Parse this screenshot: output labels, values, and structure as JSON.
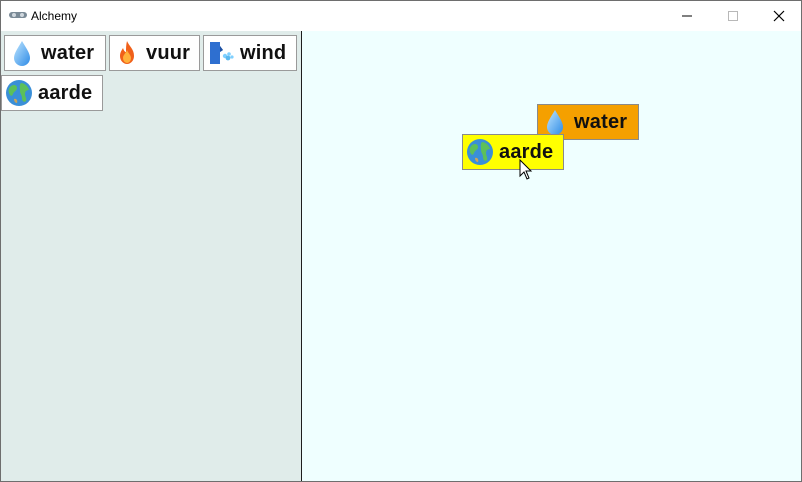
{
  "window": {
    "title": "Alchemy"
  },
  "sidebar": {
    "items": [
      {
        "label": "water",
        "icon": "water-drop-icon"
      },
      {
        "label": "vuur",
        "icon": "fire-icon"
      },
      {
        "label": "wind",
        "icon": "wind-icon"
      },
      {
        "label": "aarde",
        "icon": "earth-globe-icon"
      }
    ]
  },
  "canvas": {
    "items": [
      {
        "label": "water",
        "icon": "water-drop-icon",
        "color": "#f5a000"
      },
      {
        "label": "aarde",
        "icon": "earth-globe-icon",
        "color": "#ffff00"
      }
    ]
  },
  "colors": {
    "sidebar_bg": "#e0ecea",
    "canvas_bg": "#efffff"
  }
}
